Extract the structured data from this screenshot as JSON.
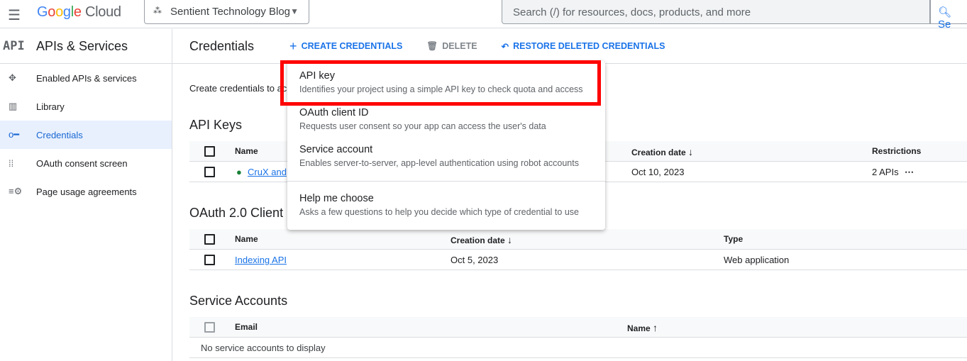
{
  "topbar": {
    "brand": "Google Cloud",
    "project": "Sentient Technology Blog",
    "search_placeholder": "Search (/) for resources, docs, products, and more",
    "search_button": "Se"
  },
  "sidebar": {
    "icon_text": "API",
    "title": "APIs & Services",
    "items": [
      {
        "label": "Enabled APIs & services",
        "icon": "enabled-apis-icon"
      },
      {
        "label": "Library",
        "icon": "library-icon"
      },
      {
        "label": "Credentials",
        "icon": "key-icon",
        "active": true
      },
      {
        "label": "OAuth consent screen",
        "icon": "oauth-consent-icon"
      },
      {
        "label": "Page usage agreements",
        "icon": "settings-list-icon"
      }
    ]
  },
  "header": {
    "title": "Credentials",
    "create": "CREATE CREDENTIALS",
    "delete": "DELETE",
    "restore": "RESTORE DELETED CREDENTIALS"
  },
  "intro": "Create credentials to ac",
  "api_keys": {
    "title": "API Keys",
    "columns": [
      "Name",
      "Creation date",
      "Restrictions"
    ],
    "rows": [
      {
        "name": "CruX and",
        "date": "Oct 10, 2023",
        "restrictions": "2 APIs",
        "more": "⋯"
      }
    ]
  },
  "oauth": {
    "title": "OAuth 2.0 Client I",
    "columns": [
      "Name",
      "Creation date",
      "Type"
    ],
    "rows": [
      {
        "name": "Indexing API",
        "date": "Oct 5, 2023",
        "type": "Web application"
      }
    ]
  },
  "service": {
    "title": "Service Accounts",
    "columns": [
      "Email",
      "Name"
    ],
    "empty": "No service accounts to display"
  },
  "menu": [
    {
      "label": "API key",
      "desc": "Identifies your project using a simple API key to check quota and access"
    },
    {
      "label": "OAuth client ID",
      "desc": "Requests user consent so your app can access the user's data"
    },
    {
      "label": "Service account",
      "desc": "Enables server-to-server, app-level authentication using robot accounts"
    },
    {
      "label": "Help me choose",
      "desc": "Asks a few questions to help you decide which type of credential to use"
    }
  ],
  "colors": {
    "accent": "#1a73e8",
    "highlight": "#ff0000"
  }
}
